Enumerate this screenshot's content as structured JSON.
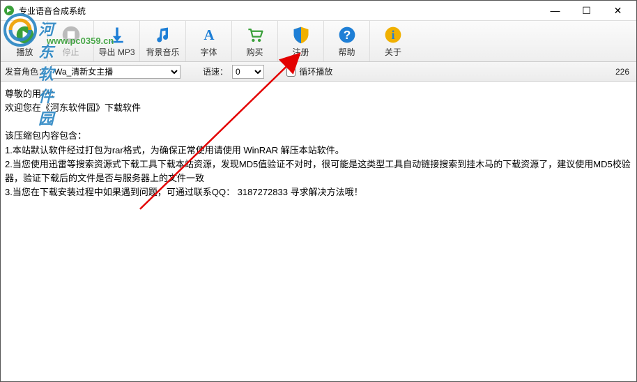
{
  "window": {
    "title": "专业语音合成系统",
    "min": "—",
    "max": "☐",
    "close": "✕"
  },
  "toolbar": {
    "play": "播放",
    "stop": "停止",
    "export": "导出 MP3",
    "bgm": "背景音乐",
    "font": "字体",
    "buy": "购买",
    "register": "注册",
    "help": "帮助",
    "about": "关于"
  },
  "options": {
    "voice_label": "发音角色：",
    "voice_value": "Wa_清新女主播",
    "speed_label": "语速：",
    "speed_value": "0",
    "loop_label": "循环播放",
    "char_count": "226"
  },
  "content": {
    "text": "尊敬的用户：\n欢迎您在《河东软件园》下载软件\n\n该压缩包内容包含：\n1.本站默认软件经过打包为rar格式，为确保正常使用请使用 WinRAR 解压本站软件。\n2.当您使用迅雷等搜索资源式下载工具下载本站资源，发现MD5值验证不对时，很可能是这类型工具自动链接搜索到挂木马的下载资源了，建议使用MD5校验器，验证下载后的文件是否与服务器上的文件一致\n3.当您在下载安装过程中如果遇到问题，可通过联系QQ： 3187272833 寻求解决方法哦！"
  },
  "watermark": {
    "site_name": "河东软件园",
    "site_url": "www.pc0359.cn"
  }
}
